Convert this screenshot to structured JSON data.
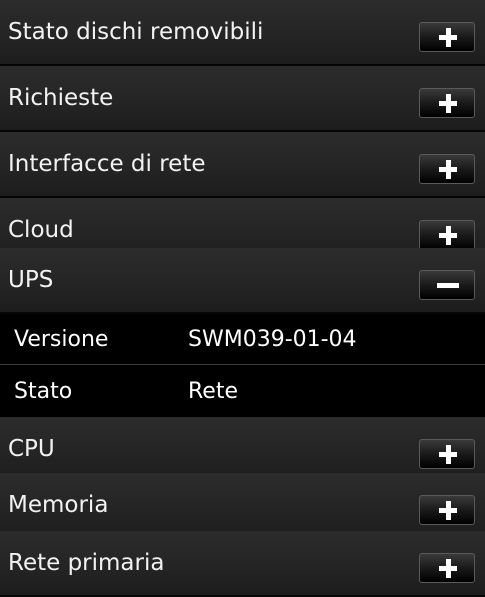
{
  "sections": [
    {
      "id": "stato-dischi-removibili",
      "label": "Stato dischi removibili",
      "expanded": false,
      "toggle_icon": "plus-icon"
    },
    {
      "id": "richieste",
      "label": "Richieste",
      "expanded": false,
      "toggle_icon": "plus-icon"
    },
    {
      "id": "interfacce-di-rete",
      "label": "Interfacce di rete",
      "expanded": false,
      "toggle_icon": "plus-icon"
    },
    {
      "id": "cloud",
      "label": "Cloud",
      "expanded": false,
      "toggle_icon": "plus-icon"
    },
    {
      "id": "ups",
      "label": "UPS",
      "expanded": true,
      "toggle_icon": "minus-icon",
      "details": [
        {
          "key": "Versione",
          "value": "SWM039-01-04"
        },
        {
          "key": "Stato",
          "value": "Rete"
        }
      ]
    },
    {
      "id": "cpu",
      "label": "CPU",
      "expanded": false,
      "toggle_icon": "plus-icon"
    },
    {
      "id": "memoria",
      "label": "Memoria",
      "expanded": false,
      "toggle_icon": "plus-icon"
    },
    {
      "id": "rete-primaria",
      "label": "Rete primaria",
      "expanded": false,
      "toggle_icon": "plus-icon"
    }
  ],
  "colors": {
    "background": "#000000",
    "header_gradient_top": "#2c2c2c",
    "header_gradient_bottom": "#1d1d1d",
    "text": "#ffffff",
    "button_border": "#5a5a5a"
  }
}
